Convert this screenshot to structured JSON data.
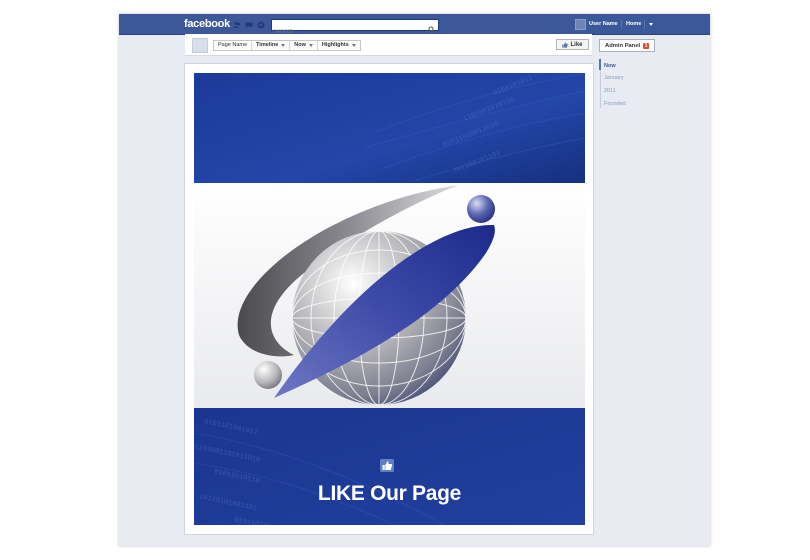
{
  "app": {
    "logo": "facebook"
  },
  "topbar": {
    "search_placeholder": "Search",
    "user_name": "User Name",
    "home_label": "Home",
    "icons": [
      "friend-requests-icon",
      "messages-icon",
      "notifications-icon",
      "search-icon",
      "account-caret-icon"
    ]
  },
  "header": {
    "breadcrumb": [
      "Page Name",
      "Timeline",
      "Now",
      "Highlights"
    ],
    "like_label": "Like"
  },
  "admin": {
    "label": "Admin Panel",
    "badge": "1"
  },
  "timeline_nav": [
    "Now",
    "January",
    "2011",
    "Founded"
  ],
  "cover": {
    "cta_text": "LIKE Our Page",
    "cta_icon": "thumbs-up-icon"
  },
  "colors": {
    "brand": "#3b5998",
    "cover_blue": "#1d3c96",
    "badge_red": "#e14b2b"
  }
}
